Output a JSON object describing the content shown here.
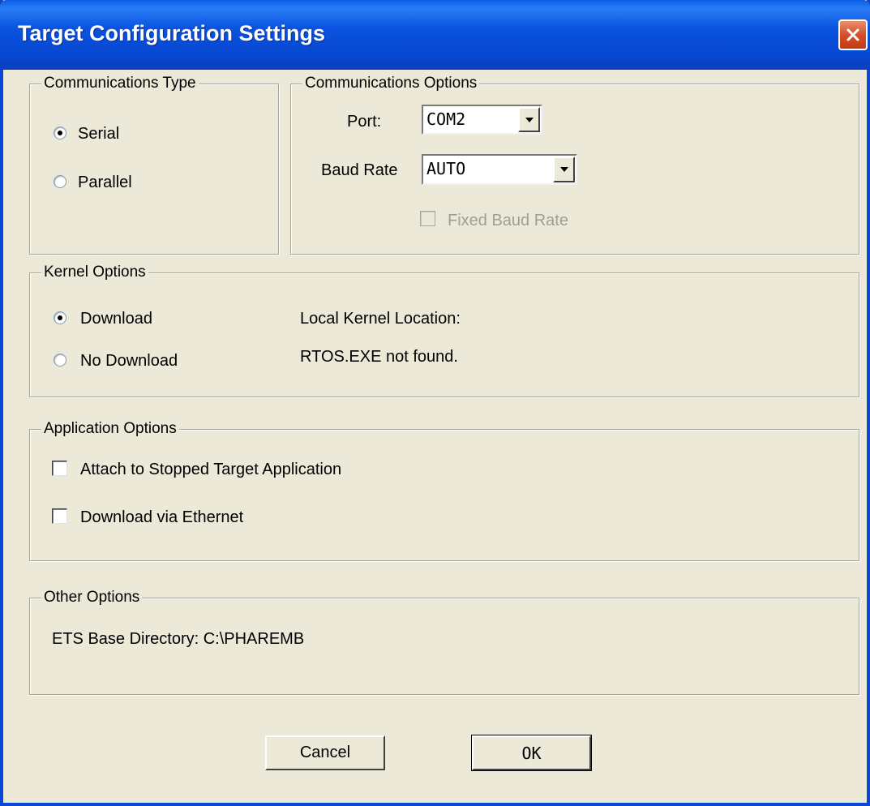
{
  "window": {
    "title": "Target Configuration Settings"
  },
  "communications_type": {
    "legend": "Communications Type",
    "options": [
      {
        "label": "Serial",
        "checked": true
      },
      {
        "label": "Parallel",
        "checked": false
      }
    ]
  },
  "communications_options": {
    "legend": "Communications Options",
    "port_label": "Port:",
    "port_value": "COM2",
    "baud_label": "Baud Rate",
    "baud_value": "AUTO",
    "fixed_baud_label": "Fixed Baud Rate",
    "fixed_baud_checked": false,
    "fixed_baud_enabled": false
  },
  "kernel_options": {
    "legend": "Kernel Options",
    "options": [
      {
        "label": "Download",
        "checked": true
      },
      {
        "label": "No Download",
        "checked": false
      }
    ],
    "location_label": "Local Kernel Location:",
    "location_status": "RTOS.EXE not found."
  },
  "application_options": {
    "legend": "Application Options",
    "items": [
      {
        "label": "Attach to Stopped Target Application",
        "checked": false
      },
      {
        "label": "Download via Ethernet",
        "checked": false
      }
    ]
  },
  "other_options": {
    "legend": "Other Options",
    "base_dir": "ETS Base Directory: C:\\PHAREMB"
  },
  "buttons": {
    "cancel": "Cancel",
    "ok": "OK"
  },
  "colors": {
    "titlebar": "#0a53e0",
    "dialog_bg": "#ece9d8",
    "close_button": "#d4502a"
  }
}
